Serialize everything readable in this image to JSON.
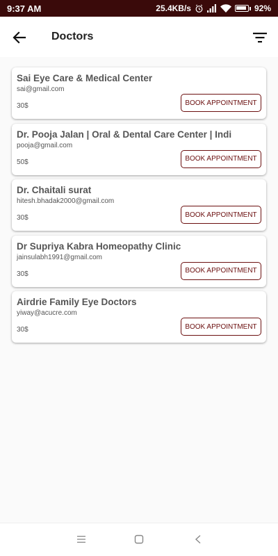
{
  "status": {
    "time": "9:37 AM",
    "net_speed": "25.4KB/s",
    "battery": "92%",
    "battery_level": 0.92
  },
  "app_bar": {
    "title": "Doctors",
    "back_icon": "arrow-back-icon",
    "filter_icon": "filter-list-icon"
  },
  "doctors": [
    {
      "name": "Sai Eye Care & Medical Center",
      "email": "sai@gmail.com",
      "price": "30$",
      "button": "BOOK APPOINTMENT"
    },
    {
      "name": "Dr. Pooja Jalan | Oral & Dental Care Center | Indi",
      "email": "pooja@gmail.com",
      "price": "50$",
      "button": "BOOK APPOINTMENT"
    },
    {
      "name": "Dr. Chaitali surat",
      "email": "hitesh.bhadak2000@gmail.com",
      "price": "30$",
      "button": "BOOK APPOINTMENT"
    },
    {
      "name": "Dr Supriya Kabra Homeopathy Clinic",
      "email": "jainsulabh1991@gmail.com",
      "price": "30$",
      "button": "BOOK APPOINTMENT"
    },
    {
      "name": "Airdrie Family Eye Doctors",
      "email": "yiway@acucre.com",
      "price": "30$",
      "button": "BOOK APPOINTMENT"
    }
  ],
  "nav": {
    "icons": [
      "menu-icon",
      "home-square-icon",
      "back-chevron-icon"
    ]
  },
  "colors": {
    "status_bar": "#3a0a0a",
    "accent": "#6b0f0f"
  }
}
